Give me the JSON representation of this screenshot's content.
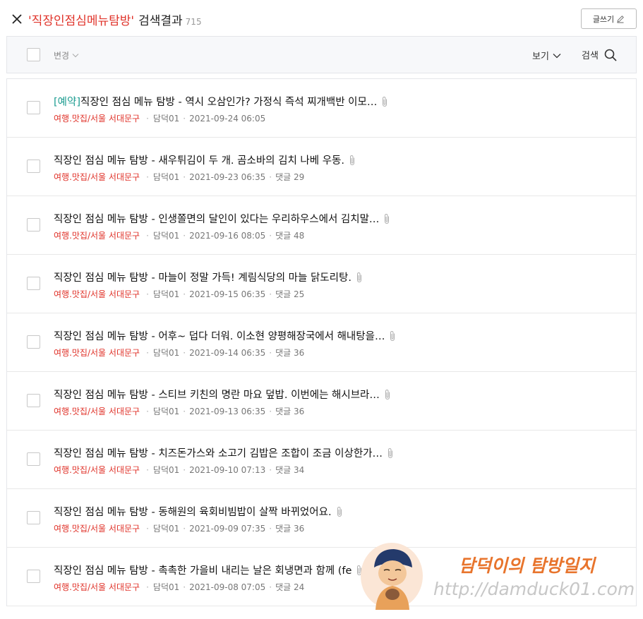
{
  "header": {
    "keyword": "'직장인점심메뉴탐방'",
    "label": "검색결과",
    "count": "715",
    "write_label": "글쓰기"
  },
  "toolbar": {
    "change_label": "변경",
    "view_label": "보기",
    "search_label": "검색"
  },
  "posts": [
    {
      "prefix": "[예약]",
      "title": "직장인 점심 메뉴 탐방 - 역시 오삼인가? 가정식 즉석 찌개백반 이모…",
      "category": "여행.맛집/서울 서대문구",
      "author": "담덕01",
      "date": "2021-09-24 06:05",
      "comments": ""
    },
    {
      "prefix": "",
      "title": "직장인 점심 메뉴 탐방 - 새우튀김이 두 개. 곰소바의 김치 나베 우동.",
      "category": "여행.맛집/서울 서대문구",
      "author": "담덕01",
      "date": "2021-09-23 06:35",
      "comments": "댓글 29"
    },
    {
      "prefix": "",
      "title": "직장인 점심 메뉴 탐방 - 인생쫄면의 달인이 있다는 우리하우스에서 김치말…",
      "category": "여행.맛집/서울 서대문구",
      "author": "담덕01",
      "date": "2021-09-16 08:05",
      "comments": "댓글 48"
    },
    {
      "prefix": "",
      "title": "직장인 점심 메뉴 탐방 - 마늘이 정말 가득! 계림식당의 마늘 닭도리탕.",
      "category": "여행.맛집/서울 서대문구",
      "author": "담덕01",
      "date": "2021-09-15 06:35",
      "comments": "댓글 25"
    },
    {
      "prefix": "",
      "title": "직장인 점심 메뉴 탐방 - 어후~ 덥다 더워. 이소현 양평해장국에서 해내탕을…",
      "category": "여행.맛집/서울 서대문구",
      "author": "담덕01",
      "date": "2021-09-14 06:35",
      "comments": "댓글 36"
    },
    {
      "prefix": "",
      "title": "직장인 점심 메뉴 탐방 - 스티브 키친의 명란 마요 덮밥. 이번에는 해시브라…",
      "category": "여행.맛집/서울 서대문구",
      "author": "담덕01",
      "date": "2021-09-13 06:35",
      "comments": "댓글 36"
    },
    {
      "prefix": "",
      "title": "직장인 점심 메뉴 탐방 - 치즈돈가스와 소고기 김밥은 조합이 조금 이상한가…",
      "category": "여행.맛집/서울 서대문구",
      "author": "담덕01",
      "date": "2021-09-10 07:13",
      "comments": "댓글 34"
    },
    {
      "prefix": "",
      "title": "직장인 점심 메뉴 탐방 - 동해원의 육회비빔밥이 살짝 바뀌었어요.",
      "category": "여행.맛집/서울 서대문구",
      "author": "담덕01",
      "date": "2021-09-09 07:35",
      "comments": "댓글 36"
    },
    {
      "prefix": "",
      "title": "직장인 점심 메뉴 탐방 - 촉촉한 가을비 내리는 날은 회냉면과 함께 (fe",
      "category": "여행.맛집/서울 서대문구",
      "author": "담덕01",
      "date": "2021-09-08 07:05",
      "comments": "댓글 24"
    }
  ],
  "watermark": {
    "title": "담덕이의 탐방일지",
    "url": "http://damduck01.com"
  },
  "colors": {
    "keyword": "#e0332a",
    "category": "#e0332a",
    "prefix": "#1a9b8f",
    "watermark_title": "#e8742c"
  }
}
